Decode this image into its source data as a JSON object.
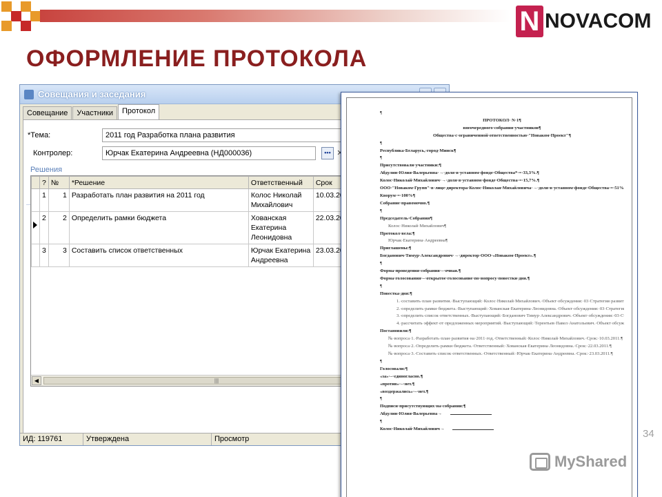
{
  "slide": {
    "title": "ОФОРМЛЕНИЕ ПРОТОКОЛА",
    "logo_letter": "N",
    "logo_text": "NOVACOM",
    "page_number": "34",
    "watermark_text": "MyShared",
    "brand_color": "#c4214f",
    "title_color": "#8a1f1f"
  },
  "window": {
    "title": "Совещания и заседания",
    "tabs": [
      {
        "label": "Совещание",
        "active": false
      },
      {
        "label": "Участники",
        "active": false
      },
      {
        "label": "Протокол",
        "active": true
      }
    ],
    "fields": {
      "topic_label": "*Тема:",
      "topic_value": "2011 год Разработка плана развития",
      "controller_label": "Контролер:",
      "controller_value": "Юрчак Екатерина Андреевна (НД000036)",
      "lookup_icon": "ellipsis-icon",
      "clear_icon": "close-icon"
    },
    "group_title": "Решения",
    "grid": {
      "columns": [
        "?",
        "№",
        "*Решение",
        "Ответственный",
        "Срок"
      ],
      "rows": [
        {
          "index": "1",
          "number": "1",
          "decision": "Разработать план развития на 2011 год",
          "responsible": "Колос Николай Михайлович",
          "deadline": "10.03.201",
          "current": false
        },
        {
          "index": "2",
          "number": "2",
          "decision": "Определить рамки бюджета",
          "responsible": "Хованская Екатерина Леонидовна",
          "deadline": "22.03.201",
          "current": true
        },
        {
          "index": "3",
          "number": "3",
          "decision": "Составить список ответственных",
          "responsible": "Юрчак Екатерина Андреевна",
          "deadline": "23.03.201",
          "current": false
        }
      ]
    },
    "status": {
      "id": "ИД: 119761",
      "state": "Утверждена",
      "mode": "Просмотр"
    }
  },
  "document": {
    "lines": [
      {
        "text": "¶",
        "style": ""
      },
      {
        "text": "ПРОТОКОЛ· N·1¶",
        "style": "c"
      },
      {
        "text": "внеочередного·собрания·участников¶",
        "style": "c"
      },
      {
        "text": "Общества·с·ограниченной·ответственностью·\"Новаком·Проект\"¶",
        "style": "c"
      },
      {
        "text": "¶",
        "style": ""
      },
      {
        "text": "Республика·Беларусь,·город·Минск¶",
        "style": "b"
      },
      {
        "text": "¶",
        "style": ""
      },
      {
        "text": "Присутствовали·участники:¶",
        "style": "b"
      },
      {
        "text": "Абдулин·Юлия·Валерьевна·→·доля·в·уставном·фонде·Общества*·=·33,3%.¶",
        "style": "b"
      },
      {
        "text": "Колос·Николай·Михайлович·→·доля·в·уставном·фонде·Общества·=·15,7%.¶",
        "style": "b"
      },
      {
        "text": "ООО·\"Новаком·Групп\"·в·лице·директора·Колос·Николая·Михайловича·→·доля·в·уставном·фонде·Общества·=·51%.¶",
        "style": "b wrap"
      },
      {
        "text": "Кворум·=·100%¶",
        "style": "b"
      },
      {
        "text": "Собрание·правомочно.¶",
        "style": "b"
      },
      {
        "text": "¶",
        "style": ""
      },
      {
        "text": "Председатель·Собрания¶",
        "style": "b"
      },
      {
        "text": "Колос·Николай·Михайлович¶",
        "style": "i2"
      },
      {
        "text": "Протокол·вела:¶",
        "style": "b"
      },
      {
        "text": "Юрчак·Екатерина·Андреевна¶",
        "style": "i2"
      },
      {
        "text": "Приглашены:¶",
        "style": "b"
      },
      {
        "text": "Богданович·Тимур·Александрович·→·директор·ООО·«Новаком·Проект».¶",
        "style": "b"
      },
      {
        "text": "¶",
        "style": ""
      },
      {
        "text": "Форма·проведения·собрания·–·очная.¶",
        "style": "b"
      },
      {
        "text": "Форма·голосования·–·открытое·голосование·по·вопросу·повестки·дня.¶",
        "style": "b"
      },
      {
        "text": "¶",
        "style": ""
      },
      {
        "text": "Повестка·дня:¶",
        "style": "b"
      },
      {
        "text": "1.·составить·план·развития.·Выступающий:·Колос·Николай·Михайлович.·Объект·обсуждения:·03·Стратегия·развития.¶",
        "style": "i1 wrap"
      },
      {
        "text": "2.·определить·рамки·бюджета.·Выступающий:·Хованская·Екатерина·Леонидовна.·Объект·обсуждения:·03·Стратегия·развития.¶",
        "style": "i1 wrap"
      },
      {
        "text": "3.·определить·список·ответственных.·Выступающий:·Богданович·Тимур·Александрович.·Объект·обсуждения:·03·Стратегия·развития.¶",
        "style": "i1 wrap"
      },
      {
        "text": "4.·рассчитать·эффект·от·предложенных·мероприятий.·Выступающий:·Терентьев·Павел·Анатольевич.·Объект·обсуждения:·03·Стратегия·развития.¶",
        "style": "i1 wrap"
      },
      {
        "text": "Постановили:¶",
        "style": "b"
      },
      {
        "text": "№·вопроса·1.·Разработать·план·развития·на·2011·год.·Ответственный:·Колос·Николай·Михайлович.·Срок:·10.03.2011.¶",
        "style": "i2 wrap"
      },
      {
        "text": "№·вопроса·2.·Определить·рамки·бюджета.·Ответственный:·Хованская·Екатерина·Леонидовна.·Срок:·22.03.2011.¶",
        "style": "i2 wrap"
      },
      {
        "text": "№·вопроса·3.·Составить·список·ответственных.·Ответственный:·Юрчак·Екатерина·Андреевна.·Срок:·23.03.2011.¶",
        "style": "i2 wrap"
      },
      {
        "text": "¶",
        "style": ""
      },
      {
        "text": "Голосовали:¶",
        "style": "b"
      },
      {
        "text": "«за»·–·единогласно.¶",
        "style": "b"
      },
      {
        "text": "«против»·–·нет.¶",
        "style": "b"
      },
      {
        "text": "«воздержались»·–·нет.¶",
        "style": "b"
      },
      {
        "text": "¶",
        "style": ""
      },
      {
        "text": "Подписи·присутствующих·на·собрании:¶",
        "style": "b"
      },
      {
        "text": "Абдулин·Юлия·Валерьевна→",
        "style": "b sig"
      },
      {
        "text": "¶",
        "style": ""
      },
      {
        "text": "Колос·Николай·Михайлович→",
        "style": "b sig"
      }
    ]
  }
}
